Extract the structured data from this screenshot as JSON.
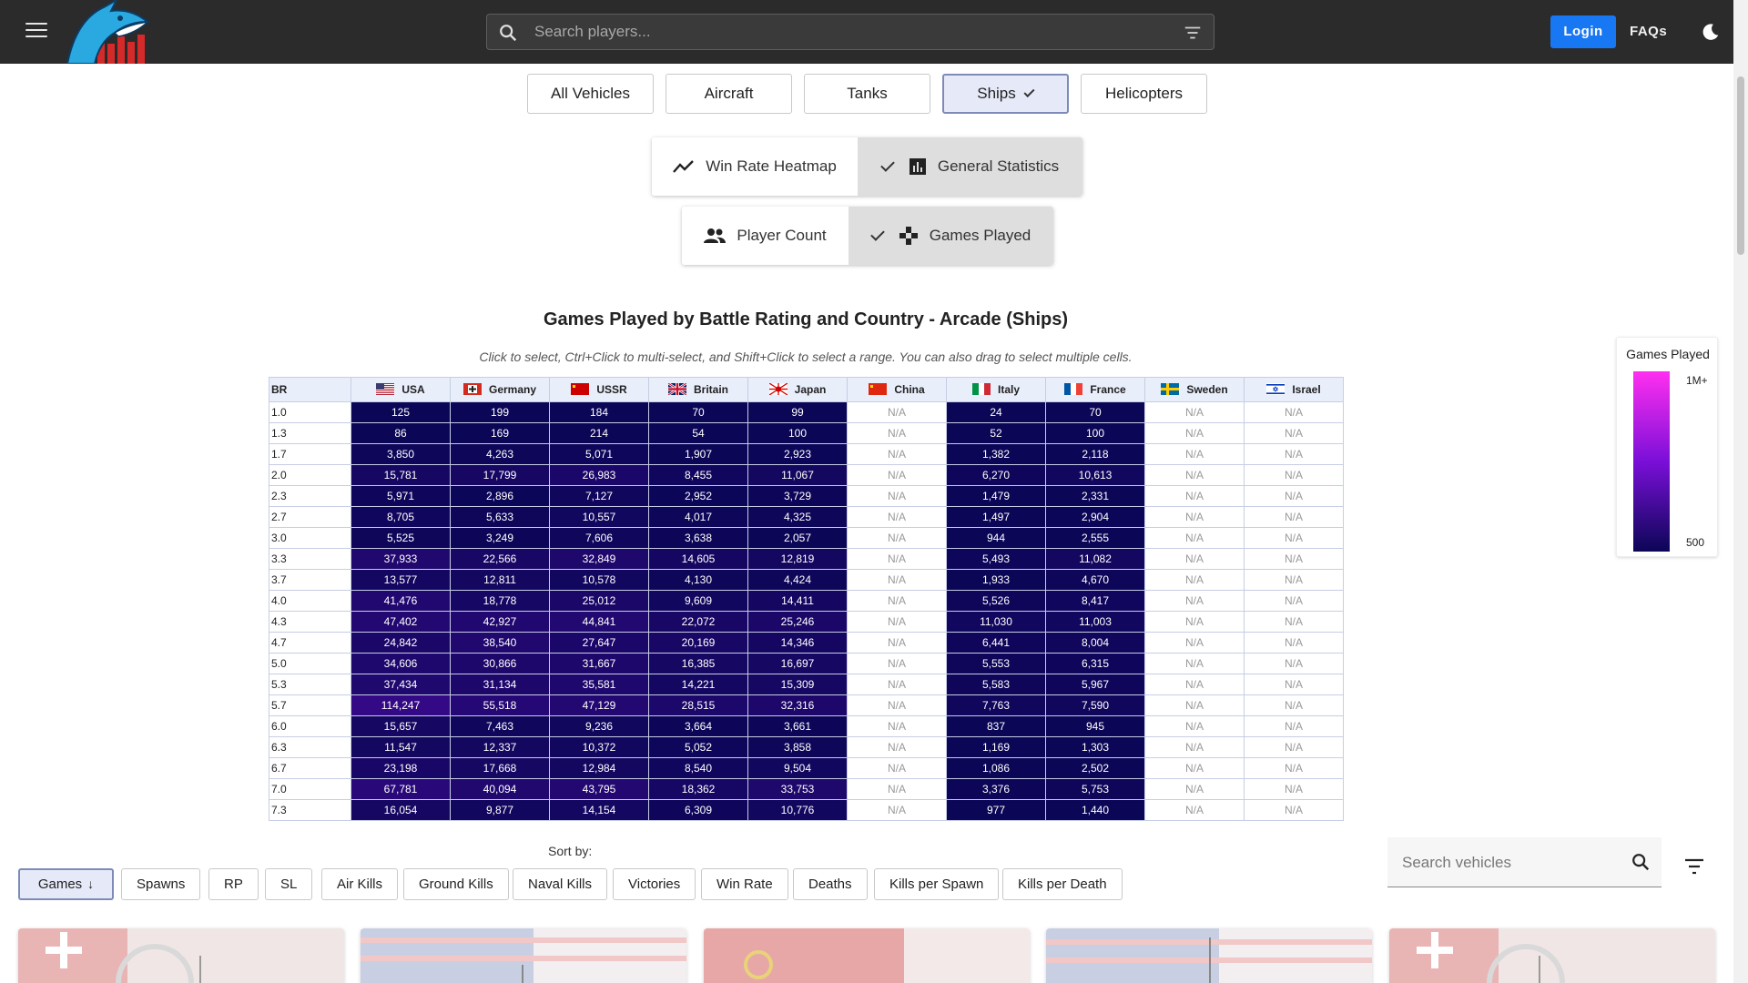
{
  "header": {
    "search_placeholder": "Search players...",
    "login_label": "Login",
    "faqs_label": "FAQs"
  },
  "vehicle_tabs": [
    {
      "label": "All Vehicles",
      "active": false
    },
    {
      "label": "Aircraft",
      "active": false
    },
    {
      "label": "Tanks",
      "active": false
    },
    {
      "label": "Ships",
      "active": true
    },
    {
      "label": "Helicopters",
      "active": false
    }
  ],
  "view_toggle": {
    "heatmap_label": "Win Rate Heatmap",
    "general_label": "General Statistics",
    "selected": "general"
  },
  "metric_toggle": {
    "player_count_label": "Player Count",
    "games_played_label": "Games Played",
    "selected": "games_played"
  },
  "chart_title": "Games Played by Battle Rating and Country - Arcade (Ships)",
  "chart_hint": "Click to select, Ctrl+Click to multi-select, and Shift+Click to select a range. You can also drag to select multiple cells.",
  "chart_data": {
    "type": "heatmap",
    "title": "Games Played by Battle Rating and Country - Arcade (Ships)",
    "row_header": "BR",
    "columns": [
      "USA",
      "Germany",
      "USSR",
      "Britain",
      "Japan",
      "China",
      "Italy",
      "France",
      "Sweden",
      "Israel"
    ],
    "rows": [
      "1.0",
      "1.3",
      "1.7",
      "2.0",
      "2.3",
      "2.7",
      "3.0",
      "3.3",
      "3.7",
      "4.0",
      "4.3",
      "4.7",
      "5.0",
      "5.3",
      "5.7",
      "6.0",
      "6.3",
      "6.7",
      "7.0",
      "7.3"
    ],
    "values": [
      [
        125,
        199,
        184,
        70,
        99,
        null,
        24,
        70,
        null,
        null
      ],
      [
        86,
        169,
        214,
        54,
        100,
        null,
        52,
        100,
        null,
        null
      ],
      [
        3850,
        4263,
        5071,
        1907,
        2923,
        null,
        1382,
        2118,
        null,
        null
      ],
      [
        15781,
        17799,
        26983,
        8455,
        11067,
        null,
        6270,
        10613,
        null,
        null
      ],
      [
        5971,
        2896,
        7127,
        2952,
        3729,
        null,
        1479,
        2331,
        null,
        null
      ],
      [
        8705,
        5633,
        10557,
        4017,
        4325,
        null,
        1497,
        2904,
        null,
        null
      ],
      [
        5525,
        3249,
        7606,
        3638,
        2057,
        null,
        944,
        2555,
        null,
        null
      ],
      [
        37933,
        22566,
        32849,
        14605,
        12819,
        null,
        5493,
        11082,
        null,
        null
      ],
      [
        13577,
        12811,
        10578,
        4130,
        4424,
        null,
        1933,
        4670,
        null,
        null
      ],
      [
        41476,
        18778,
        25012,
        9609,
        14411,
        null,
        5526,
        8417,
        null,
        null
      ],
      [
        47402,
        42927,
        44841,
        22072,
        25246,
        null,
        11030,
        11003,
        null,
        null
      ],
      [
        24842,
        38540,
        27647,
        20169,
        14346,
        null,
        6441,
        8004,
        null,
        null
      ],
      [
        34606,
        30866,
        31667,
        16385,
        16697,
        null,
        5553,
        6315,
        null,
        null
      ],
      [
        37434,
        31134,
        35581,
        14221,
        15309,
        null,
        5583,
        5967,
        null,
        null
      ],
      [
        114247,
        55518,
        47129,
        28515,
        32316,
        null,
        7763,
        7590,
        null,
        null
      ],
      [
        15657,
        7463,
        9236,
        3664,
        3661,
        null,
        837,
        945,
        null,
        null
      ],
      [
        11547,
        12337,
        10372,
        5052,
        3858,
        null,
        1169,
        1303,
        null,
        null
      ],
      [
        23198,
        17668,
        12984,
        8540,
        9504,
        null,
        1086,
        2502,
        null,
        null
      ],
      [
        67781,
        40094,
        43795,
        18362,
        33753,
        null,
        3376,
        5753,
        null,
        null
      ],
      [
        16054,
        9877,
        14154,
        6309,
        10776,
        null,
        977,
        1440,
        null,
        null
      ]
    ],
    "na_label": "N/A",
    "legend": {
      "title": "Games Played",
      "max_label": "1M+",
      "min_label": "500"
    }
  },
  "sort": {
    "label": "Sort by:",
    "options": [
      "Games",
      "Spawns",
      "RP",
      "SL",
      "Air Kills",
      "Ground Kills",
      "Naval Kills",
      "Victories",
      "Win Rate",
      "Deaths",
      "Kills per Spawn",
      "Kills per Death"
    ],
    "active": "Games",
    "active_direction": "descending"
  },
  "vehicle_search_placeholder": "Search vehicles",
  "colors": {
    "topbar": "#2b2b2b",
    "login": "#1877f2",
    "heat_low": "#0b0656",
    "heat_high": "#ff2ff0"
  }
}
